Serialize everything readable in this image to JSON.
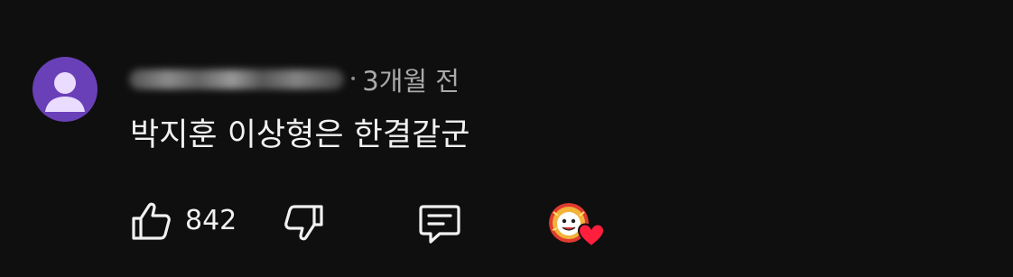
{
  "comment": {
    "avatar_icon": "user-avatar-placeholder-icon",
    "timestamp": "3개월 전",
    "text": "박지훈 이상형은 한결같군",
    "accent_colors": {
      "background": "#0f0f0f",
      "avatar": "#6a40b8",
      "heart": "#ff1f3d"
    }
  },
  "actions": {
    "like_icon": "thumbs-up-icon",
    "like_count": "842",
    "dislike_icon": "thumbs-down-icon",
    "reply_icon": "reply-comment-icon",
    "creator_heart_icon": "creator-heart-icon"
  }
}
